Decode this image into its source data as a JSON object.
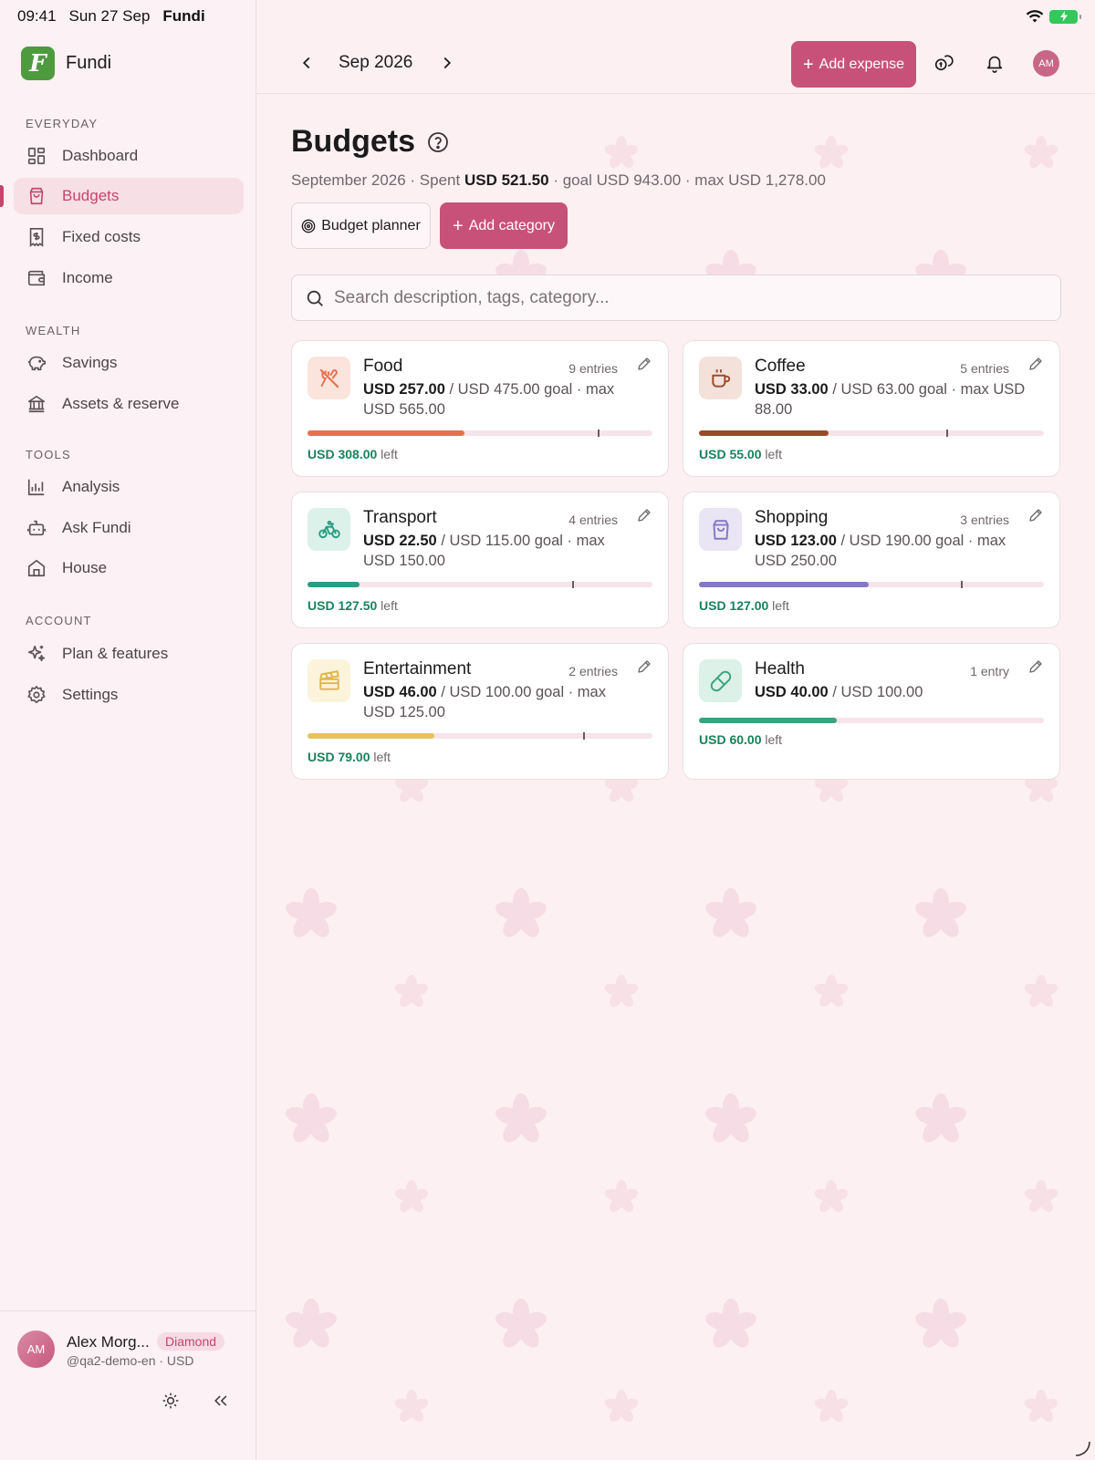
{
  "statusbar": {
    "time": "09:41",
    "date": "Sun 27 Sep",
    "app": "Fundi"
  },
  "brand": {
    "name": "Fundi",
    "logo_letter": "F"
  },
  "colors": {
    "accent": "#c8517a",
    "brand_green": "#4e9a3f",
    "positive": "#17835c"
  },
  "sidebar": {
    "sections": [
      {
        "label": "EVERYDAY"
      },
      {
        "label": "WEALTH"
      },
      {
        "label": "TOOLS"
      },
      {
        "label": "ACCOUNT"
      }
    ],
    "items": [
      {
        "label": "Dashboard",
        "icon": "dashboard-icon"
      },
      {
        "label": "Budgets",
        "icon": "shopping-bag-icon",
        "active": true
      },
      {
        "label": "Fixed costs",
        "icon": "receipt-icon"
      },
      {
        "label": "Income",
        "icon": "wallet-icon"
      },
      {
        "label": "Savings",
        "icon": "piggy-bank-icon"
      },
      {
        "label": "Assets & reserve",
        "icon": "bank-icon"
      },
      {
        "label": "Analysis",
        "icon": "bar-chart-icon"
      },
      {
        "label": "Ask Fundi",
        "icon": "bot-icon"
      },
      {
        "label": "House",
        "icon": "home-icon"
      },
      {
        "label": "Plan & features",
        "icon": "sparkles-icon"
      },
      {
        "label": "Settings",
        "icon": "gear-icon"
      }
    ],
    "user": {
      "initials": "AM",
      "name": "Alex Morg...",
      "badge": "Diamond",
      "handle": "@qa2-demo-en · USD"
    }
  },
  "topbar": {
    "month": "Sep 2026",
    "add_expense_label": "Add expense",
    "avatar_initials": "AM"
  },
  "page": {
    "title": "Budgets",
    "summary": {
      "period": "September 2026 · Spent",
      "spent": "USD 521.50",
      "rest": "· goal USD 943.00 · max USD 1,278.00"
    },
    "planner_label": "Budget planner",
    "add_category_label": "Add category",
    "search_placeholder": "Search description, tags, category..."
  },
  "categories": [
    {
      "name": "Food",
      "icon": "utensils-off-icon",
      "color": "#e8704f",
      "icon_bg": "#fbe4dc",
      "entries": "9 entries",
      "spent": "USD 257.00",
      "detail": "/ USD 475.00 goal · max USD 565.00",
      "left_amount": "USD 308.00",
      "left_word": "left",
      "progress": 0.455,
      "goal_marker": 0.841
    },
    {
      "name": "Coffee",
      "icon": "coffee-cup-icon",
      "color": "#9b4a2a",
      "icon_bg": "#f3e1da",
      "entries": "5 entries",
      "spent": "USD 33.00",
      "detail": "/ USD 63.00 goal · max USD 88.00",
      "left_amount": "USD 55.00",
      "left_word": "left",
      "progress": 0.375,
      "goal_marker": 0.716
    },
    {
      "name": "Transport",
      "icon": "bicycle-icon",
      "color": "#2a9d82",
      "icon_bg": "#dcf1ea",
      "entries": "4 entries",
      "spent": "USD 22.50",
      "detail": "/ USD 115.00 goal · max USD 150.00",
      "left_amount": "USD 127.50",
      "left_word": "left",
      "progress": 0.15,
      "goal_marker": 0.767
    },
    {
      "name": "Shopping",
      "icon": "shopping-bag-icon",
      "color": "#8577c8",
      "icon_bg": "#e9e5f5",
      "entries": "3 entries",
      "spent": "USD 123.00",
      "detail": "/ USD 190.00 goal · max USD 250.00",
      "left_amount": "USD 127.00",
      "left_word": "left",
      "progress": 0.492,
      "goal_marker": 0.76
    },
    {
      "name": "Entertainment",
      "icon": "clapperboard-icon",
      "color": "#e6c25a",
      "icon_bg": "#fcf3dc",
      "entries": "2 entries",
      "spent": "USD 46.00",
      "detail": "/ USD 100.00 goal · max USD 125.00",
      "left_amount": "USD 79.00",
      "left_word": "left",
      "progress": 0.368,
      "goal_marker": 0.8
    },
    {
      "name": "Health",
      "icon": "pill-icon",
      "color": "#3aa380",
      "icon_bg": "#dcf1e7",
      "entries": "1 entry",
      "spent": "USD 40.00",
      "detail": "/ USD 100.00",
      "left_amount": "USD 60.00",
      "left_word": "left",
      "progress": 0.4,
      "goal_marker": null
    }
  ]
}
